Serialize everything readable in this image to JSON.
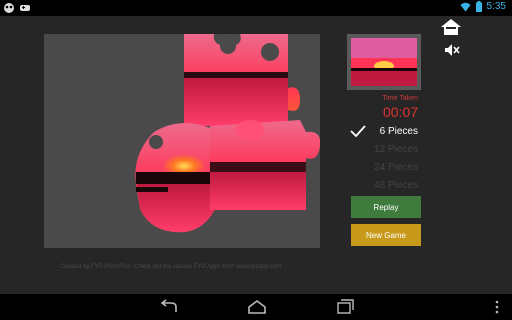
{
  "status": {
    "time": "5:35",
    "left_icons": [
      "alien-icon",
      "game-controller-icon"
    ],
    "right_icons": [
      "wifi-icon",
      "battery-icon"
    ]
  },
  "header": {
    "home_icon": "home-icon",
    "mute_icon": "mute-icon"
  },
  "timer": {
    "label": "Time Taken",
    "value": "00:07"
  },
  "piece_options": [
    {
      "label": "6 Pieces",
      "selected": true
    },
    {
      "label": "12 Pieces",
      "selected": false
    },
    {
      "label": "24 Pieces",
      "selected": false
    },
    {
      "label": "48 Pieces",
      "selected": false
    }
  ],
  "buttons": {
    "replay": "Replay",
    "new_game": "New Game"
  },
  "credit": "Created by FYD PhotoFun. Check out the various FYD Apps from www.fyzapp.com",
  "navbar": {
    "back_icon": "back-icon",
    "home_icon": "nav-home-icon",
    "recent_icon": "recent-apps-icon",
    "menu_icon": "overflow-menu-icon"
  },
  "colors": {
    "timer_red": "#e03232",
    "replay_green": "#3f7b3c",
    "new_game_gold": "#c89a1c",
    "status_blue": "#3ab4e6"
  }
}
